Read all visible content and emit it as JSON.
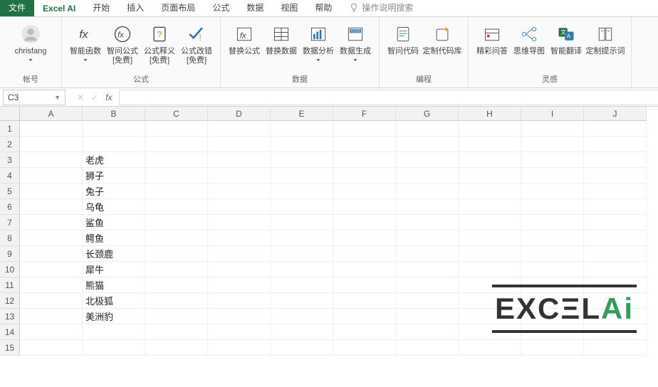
{
  "tabs": {
    "file": "文件",
    "excel_ai": "Excel AI",
    "home": "开始",
    "insert": "插入",
    "layout": "页面布局",
    "formulas": "公式",
    "data": "数据",
    "view": "视图",
    "help": "帮助",
    "tell_me": "操作说明搜索"
  },
  "ribbon": {
    "account": {
      "name": "chrisfang",
      "group": "帐号"
    },
    "group_formula": {
      "label": "公式",
      "btn_fn": "智能函数",
      "btn_ask": "智问公式\n[免费]",
      "btn_explain": "公式释义\n[免费]",
      "btn_fix": "公式改错\n[免费]"
    },
    "group_data": {
      "label": "数据",
      "btn_rep": "替换公式",
      "btn_swap": "替换数据",
      "btn_analyze": "数据分析",
      "btn_gen": "数据生成"
    },
    "group_code": {
      "label": "编程",
      "btn_ask": "智问代码",
      "btn_lib": "定制代码库"
    },
    "group_insp": {
      "label": "灵感",
      "btn_qa": "精彩问答",
      "btn_mind": "思维导图",
      "btn_trans": "智能翻译",
      "btn_prompt": "定制提示词"
    }
  },
  "fbar": {
    "cellref": "C3",
    "fx": "fx",
    "value": ""
  },
  "grid": {
    "cols": [
      "A",
      "B",
      "C",
      "D",
      "E",
      "F",
      "G",
      "H",
      "I",
      "J"
    ],
    "rows": [
      "1",
      "2",
      "3",
      "4",
      "5",
      "6",
      "7",
      "8",
      "9",
      "10",
      "11",
      "12",
      "13",
      "14",
      "15"
    ],
    "data_b": [
      "",
      "",
      "老虎",
      "狮子",
      "兔子",
      "乌龟",
      "鲨鱼",
      "鳄鱼",
      "长颈鹿",
      "犀牛",
      "熊猫",
      "北极狐",
      "美洲豹",
      "",
      ""
    ]
  },
  "watermark": {
    "a": "EXC",
    "b": "Ξ",
    "c": "L",
    "ai": "Ai"
  }
}
